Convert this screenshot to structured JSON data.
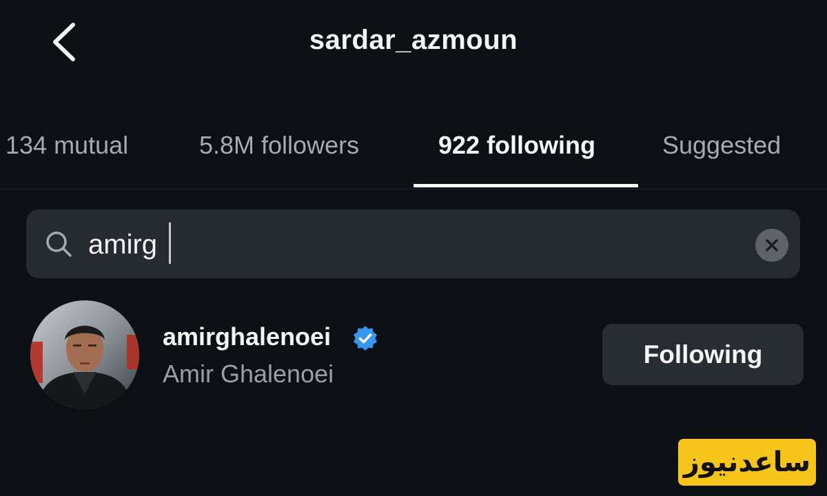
{
  "header": {
    "back_icon": "chevron-left-icon",
    "title": "sardar_azmoun"
  },
  "tabs": [
    {
      "label": "134 mutual",
      "active": false
    },
    {
      "label": "5.8M followers",
      "active": false
    },
    {
      "label": "922 following",
      "active": true
    },
    {
      "label": "Suggested",
      "active": false
    }
  ],
  "search": {
    "icon": "search-icon",
    "value": "amirg",
    "clear_icon": "close-icon"
  },
  "results": [
    {
      "username": "amirghalenoei",
      "verified": true,
      "full_name": "Amir Ghalenoei",
      "action_label": "Following"
    }
  ],
  "watermark": {
    "text": "ساعدنیوز"
  },
  "colors": {
    "background": "#0c0f14",
    "search_bg": "#262a31",
    "button_bg": "#272b32",
    "verified_blue": "#3797f0",
    "watermark_bg": "#f7c51a"
  }
}
